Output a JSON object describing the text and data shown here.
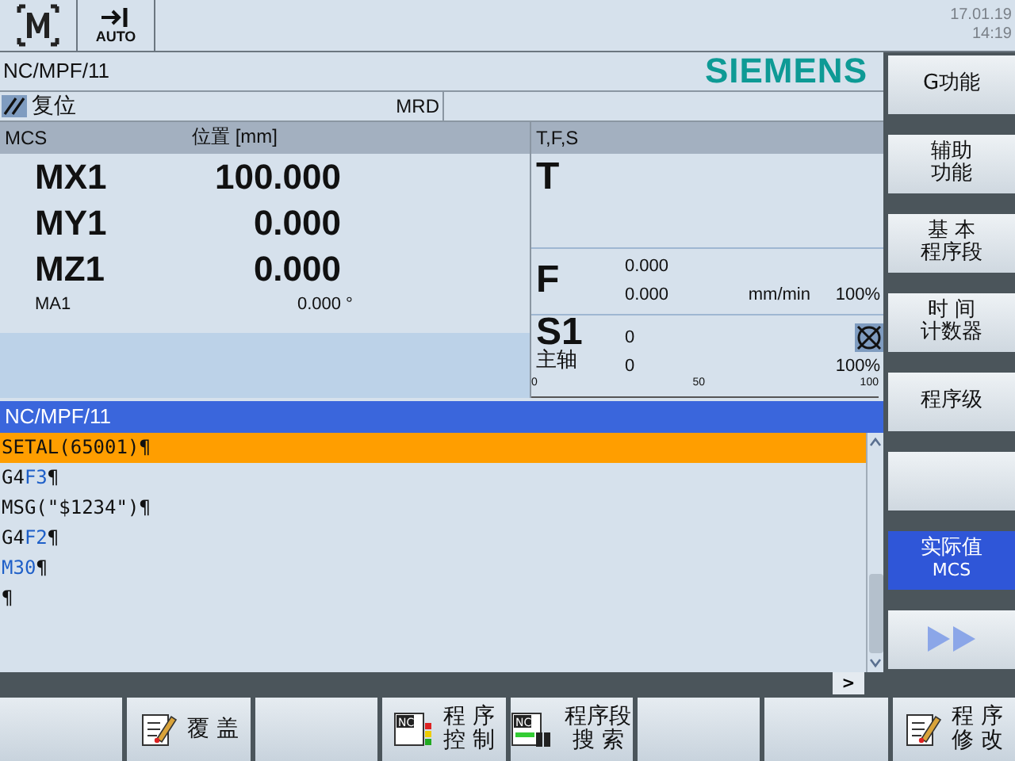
{
  "top_bar": {
    "mode_label": "AUTO",
    "date": "17.01.19",
    "time": "14:19"
  },
  "header": {
    "path": "NC/MPF/11",
    "brand": "SIEMENS"
  },
  "status": {
    "state": "复位",
    "mode": "MRD"
  },
  "position_panel": {
    "columns": [
      "MCS",
      "位置 [mm]"
    ],
    "axes": [
      {
        "name": "MX1",
        "value": "100.000",
        "kind": "large"
      },
      {
        "name": "MY1",
        "value": "0.000",
        "kind": "large"
      },
      {
        "name": "MZ1",
        "value": "0.000",
        "kind": "large"
      },
      {
        "name": "MA1",
        "value": "0.000",
        "unit": "°",
        "kind": "small"
      }
    ]
  },
  "tfs_panel": {
    "title": "T,F,S",
    "tool": {
      "label": "T"
    },
    "feed": {
      "label": "F",
      "setpoint": "0.000",
      "actual": "0.000",
      "unit": "mm/min",
      "override": "100%"
    },
    "spindle": {
      "label": "S1",
      "sublabel": "主轴",
      "setpoint": "0",
      "actual": "0",
      "override": "100%",
      "scale": [
        "0",
        "50",
        "100"
      ]
    }
  },
  "program": {
    "title": "NC/MPF/11",
    "lines": [
      {
        "selected": true,
        "parts": [
          {
            "text": "SETAL(65001)¶",
            "highlight": false
          }
        ]
      },
      {
        "selected": false,
        "parts": [
          {
            "text": "G4",
            "highlight": false
          },
          {
            "text": "F3",
            "highlight": true
          },
          {
            "text": "¶",
            "highlight": false
          }
        ]
      },
      {
        "selected": false,
        "parts": [
          {
            "text": "MSG(\"$1234\")¶",
            "highlight": false
          }
        ]
      },
      {
        "selected": false,
        "parts": [
          {
            "text": "G4",
            "highlight": false
          },
          {
            "text": "F2",
            "highlight": true
          },
          {
            "text": "¶",
            "highlight": false
          }
        ]
      },
      {
        "selected": false,
        "parts": [
          {
            "text": "M30",
            "highlight": true
          },
          {
            "text": "¶",
            "highlight": false
          }
        ]
      },
      {
        "selected": false,
        "parts": [
          {
            "text": "¶",
            "highlight": false
          }
        ]
      }
    ],
    "scroll_button": ">"
  },
  "side_softkeys": [
    {
      "lines": [
        "G功能"
      ],
      "selected": false,
      "kind": "text"
    },
    {
      "lines": [
        "辅助",
        "功能"
      ],
      "selected": false,
      "kind": "text"
    },
    {
      "lines": [
        "基 本",
        "程序段"
      ],
      "selected": false,
      "kind": "text"
    },
    {
      "lines": [
        "时 间",
        "计数器"
      ],
      "selected": false,
      "kind": "text"
    },
    {
      "lines": [
        "程序级"
      ],
      "selected": false,
      "kind": "text"
    },
    {
      "selected": false,
      "kind": "blank"
    },
    {
      "lines": [
        "实际值",
        "MCS"
      ],
      "selected": true,
      "kind": "text"
    },
    {
      "selected": false,
      "kind": "more"
    }
  ],
  "bottom_softkeys": [
    {
      "kind": "blank"
    },
    {
      "lines": [
        "覆 盖"
      ],
      "kind": "edit"
    },
    {
      "kind": "blank"
    },
    {
      "lines": [
        "程 序",
        "控 制"
      ],
      "kind": "nc-control",
      "icon_text": "NC"
    },
    {
      "lines": [
        "程序段",
        "搜 索"
      ],
      "kind": "nc-search",
      "icon_text": "NC"
    },
    {
      "kind": "blank"
    },
    {
      "kind": "blank"
    },
    {
      "lines": [
        "程 序",
        "修 改"
      ],
      "kind": "edit"
    }
  ]
}
